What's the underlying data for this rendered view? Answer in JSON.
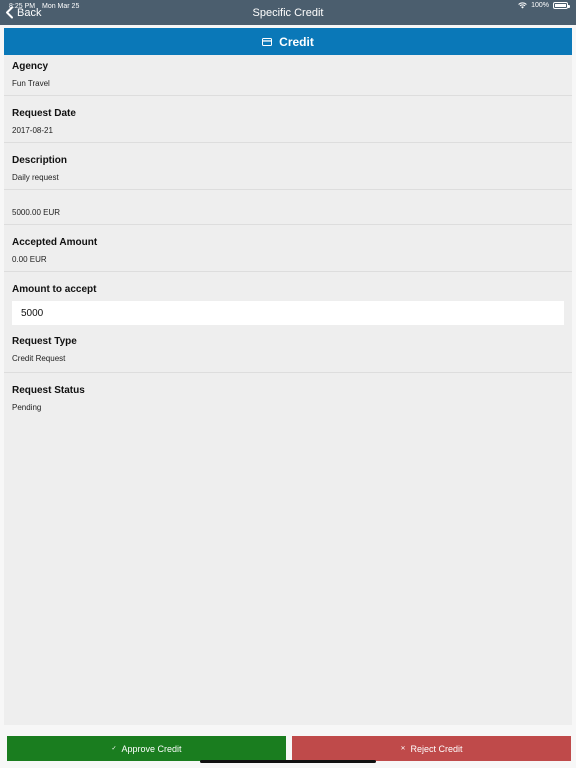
{
  "status_bar": {
    "time": "8:25 PM",
    "date": "Mon Mar 25",
    "battery": "100%"
  },
  "nav": {
    "back_label": "Back",
    "title": "Specific Credit"
  },
  "panel": {
    "title": "Credit",
    "icon": "credit-card-icon"
  },
  "fields": {
    "agency": {
      "label": "Agency",
      "value": "Fun Travel"
    },
    "request_date": {
      "label": "Request Date",
      "value": "2017-08-21"
    },
    "description": {
      "label": "Description",
      "value": "Daily request"
    },
    "amount": {
      "value": "5000.00 EUR"
    },
    "accepted_amount": {
      "label": "Accepted Amount",
      "value": "0.00 EUR"
    },
    "amount_to_accept": {
      "label": "Amount to accept",
      "value": "5000"
    },
    "request_type": {
      "label": "Request Type",
      "value": "Credit Request"
    },
    "request_status": {
      "label": "Request Status",
      "value": "Pending"
    }
  },
  "actions": {
    "approve": {
      "label": "Approve Credit",
      "icon": "check-icon",
      "color": "#1a7d1f"
    },
    "reject": {
      "label": "Reject Credit",
      "icon": "close-icon",
      "color": "#bf4a4a"
    }
  },
  "colors": {
    "nav_bar": "#4b5e6e",
    "panel_header": "#0a78b8",
    "panel_background": "#eeeeee"
  }
}
